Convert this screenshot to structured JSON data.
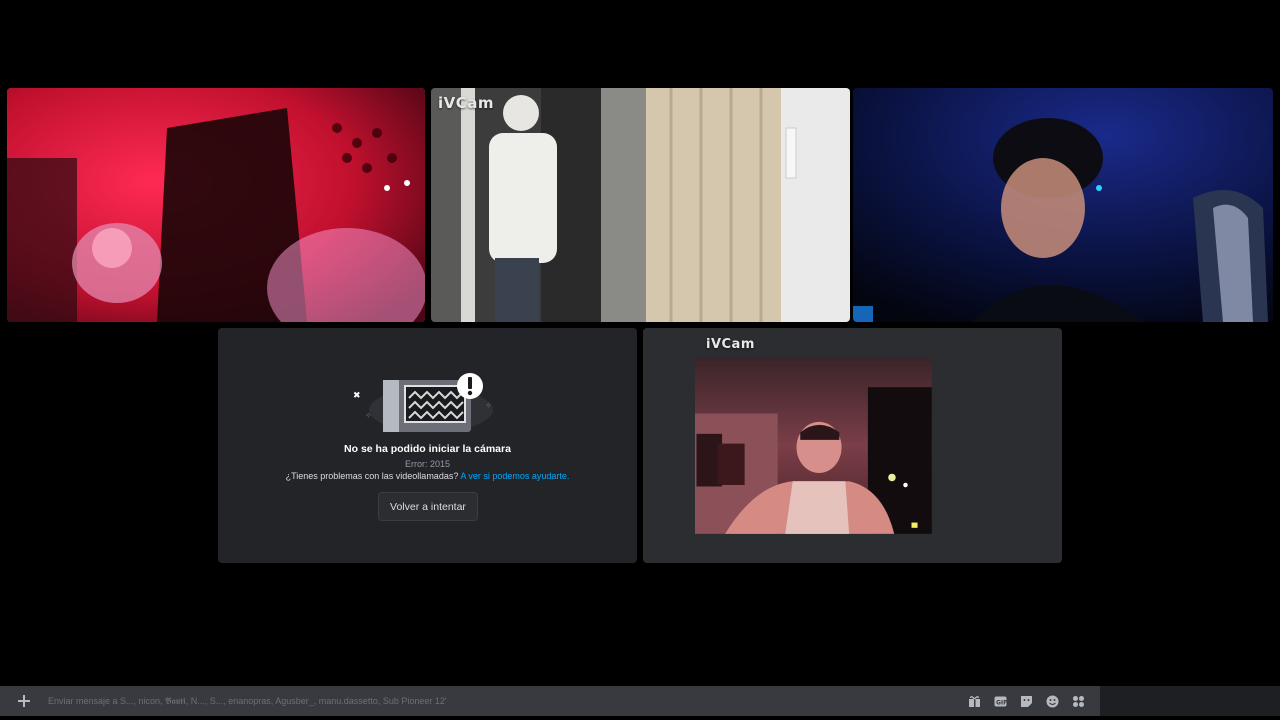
{
  "tiles": [
    {
      "id": "tile-1",
      "label": ""
    },
    {
      "id": "tile-2",
      "label": "iVCam"
    },
    {
      "id": "tile-3",
      "label": ""
    },
    {
      "id": "tile-5",
      "label": "iVCam"
    }
  ],
  "camera_error": {
    "title": "No se ha podido iniciar la cámara",
    "code": "Error: 2015",
    "help_text": "¿Tienes problemas con las videollamadas?",
    "help_link": "A ver si podemos ayudarte.",
    "retry_label": "Volver a intentar"
  },
  "chat": {
    "placeholder": "Enviar mensaje a S..., nicon, 𝕭𝖆𝖚𝖙𝖎, N..., S..., enanopras, Agusber_, manu.dassetto, Sub Pioneer 12'",
    "icons": [
      "gift-icon",
      "gif-icon",
      "sticker-icon",
      "emoji-icon",
      "apps-icon"
    ]
  },
  "colors": {
    "background": "#000000",
    "tile_bg": "#1e1f22",
    "speaking_border": "#3ba55c",
    "link": "#00a8fc",
    "chat_bar": "#383a40"
  }
}
